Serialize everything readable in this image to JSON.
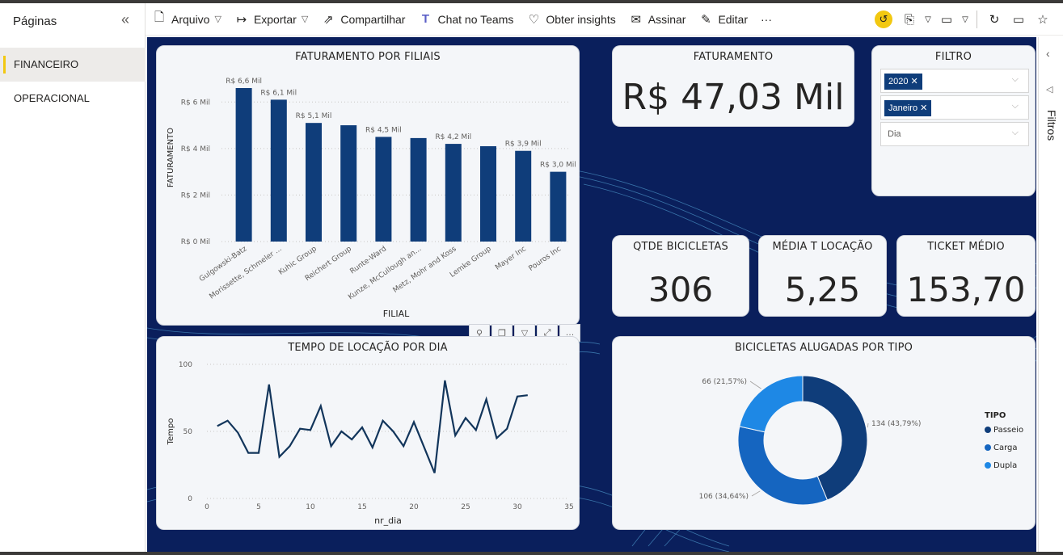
{
  "pages_pane": {
    "title": "Páginas",
    "collapse_icon": "double-chevron-left-icon",
    "items": [
      {
        "label": "FINANCEIRO",
        "active": true
      },
      {
        "label": "OPERACIONAL",
        "active": false
      }
    ]
  },
  "toolbar": {
    "arquivo": "Arquivo",
    "exportar": "Exportar",
    "compartilhar": "Compartilhar",
    "chat_teams": "Chat no Teams",
    "obter_insights": "Obter insights",
    "assinar": "Assinar",
    "editar": "Editar",
    "more": "···"
  },
  "colors": {
    "canvas_bg": "#0a1f5c",
    "bar": "#0f3d7a",
    "line": "#12355b",
    "passeio": "#0f3d7a",
    "carga": "#1565c0",
    "dupla": "#1e88e5",
    "reset": "#f2c811"
  },
  "cards": {
    "faturamento_filiais_title": "FATURAMENTO POR FILIAIS",
    "faturamento_title": "FATURAMENTO",
    "faturamento_value": "R$ 47,03 Mil",
    "filtro_title": "FILTRO",
    "qtde_title": "QTDE BICICLETAS",
    "qtde_value": "306",
    "media_title": "MÉDIA T LOCAÇÃO",
    "media_value": "5,25",
    "ticket_title": "TICKET MÉDIO",
    "ticket_value": "153,70",
    "tempo_title": "TEMPO DE LOCAÇÃO POR DIA",
    "bicicletas_title": "BICICLETAS ALUGADAS POR TIPO"
  },
  "filtro": {
    "ano_chip": "2020",
    "mes_chip": "Janeiro",
    "dia_placeholder": "Dia"
  },
  "filters_pane": {
    "label": "Filtros"
  },
  "chart_data": [
    {
      "type": "bar",
      "title": "FATURAMENTO POR FILIAIS",
      "xlabel": "FILIAL",
      "ylabel": "FATURAMENTO",
      "ylim": [
        0,
        6.6
      ],
      "yticks": [
        "R$ 0 Mil",
        "R$ 2 Mil",
        "R$ 4 Mil",
        "R$ 6 Mil"
      ],
      "categories": [
        "Gulgowski-Batz",
        "Morissette, Schmeler ...",
        "Kuhic Group",
        "Reichert Group",
        "Runte-Ward",
        "Kunze, McCullough an...",
        "Metz, Mohr and Koss",
        "Lemke Group",
        "Mayer Inc",
        "Pouros Inc"
      ],
      "values": [
        6.6,
        6.1,
        5.1,
        5.0,
        4.5,
        4.45,
        4.2,
        4.1,
        3.9,
        3.0
      ],
      "data_labels": [
        "R$ 6,6 Mil",
        "R$ 6,1 Mil",
        "R$ 5,1 Mil",
        "",
        "R$ 4,5 Mil",
        "",
        "R$ 4,2 Mil",
        "",
        "R$ 3,9 Mil",
        "R$ 3,0 Mil"
      ]
    },
    {
      "type": "line",
      "title": "TEMPO DE LOCAÇÃO POR DIA",
      "xlabel": "nr_dia",
      "ylabel": "Tempo",
      "xlim": [
        0,
        35
      ],
      "ylim": [
        0,
        100
      ],
      "xticks": [
        "0",
        "5",
        "10",
        "15",
        "20",
        "25",
        "30",
        "35"
      ],
      "yticks": [
        "0",
        "50",
        "100"
      ],
      "x": [
        1,
        2,
        3,
        4,
        5,
        6,
        7,
        8,
        9,
        10,
        11,
        12,
        13,
        14,
        15,
        16,
        17,
        18,
        19,
        20,
        21,
        22,
        23,
        24,
        25,
        26,
        27,
        28,
        29,
        30,
        31
      ],
      "y": [
        54,
        58,
        49,
        34,
        34,
        85,
        31,
        39,
        52,
        51,
        69,
        39,
        50,
        44,
        53,
        38,
        58,
        50,
        39,
        57,
        38,
        19,
        88,
        47,
        60,
        51,
        74,
        45,
        52,
        76,
        77
      ]
    },
    {
      "type": "pie",
      "title": "BICICLETAS ALUGADAS POR TIPO",
      "legend_title": "TIPO",
      "legend_placement": "right",
      "labels": [
        "Passeio",
        "Carga",
        "Dupla"
      ],
      "values": [
        134,
        106,
        66
      ],
      "data_labels": [
        "134 (43,79%)",
        "106 (34,64%)",
        "66 (21,57%)"
      ]
    }
  ]
}
